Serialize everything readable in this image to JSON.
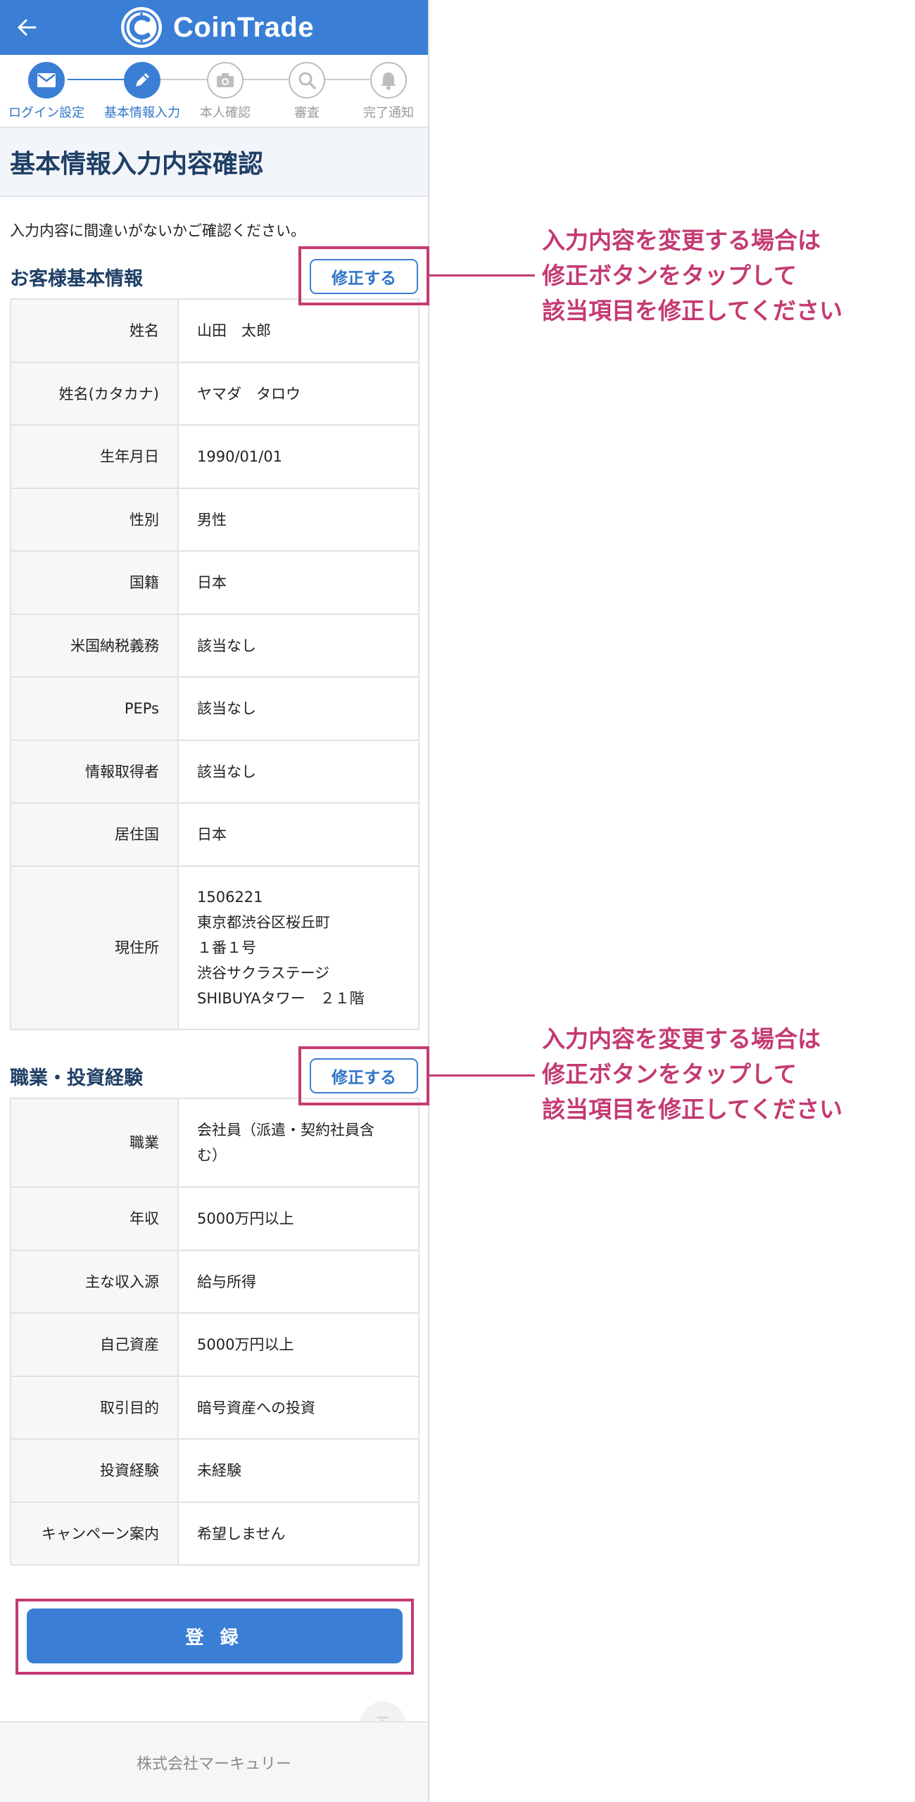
{
  "app": {
    "logo_text": "CoinTrade",
    "brand_color": "#3a7fd5",
    "accent_color": "#c43a72"
  },
  "header": {
    "back_icon": "arrow-left-icon",
    "logo_icon": "coin-logo-icon"
  },
  "steps": [
    {
      "label": "ログイン設定",
      "icon": "envelope-icon",
      "active": true
    },
    {
      "label": "基本情報入力",
      "icon": "pencil-icon",
      "active": true
    },
    {
      "label": "本人確認",
      "icon": "camera-icon",
      "active": false
    },
    {
      "label": "審査",
      "icon": "search-icon",
      "active": false
    },
    {
      "label": "完了通知",
      "icon": "bell-icon",
      "active": false
    }
  ],
  "page": {
    "title": "基本情報入力内容確認",
    "intro": "入力内容に間違いがないかご確認ください。"
  },
  "section1": {
    "title": "お客様基本情報",
    "edit_label": "修正する",
    "rows": [
      {
        "label": "姓名",
        "value": "山田　太郎"
      },
      {
        "label": "姓名(カタカナ)",
        "value": "ヤマダ　タロウ"
      },
      {
        "label": "生年月日",
        "value": "1990/01/01"
      },
      {
        "label": "性別",
        "value": "男性"
      },
      {
        "label": "国籍",
        "value": "日本"
      },
      {
        "label": "米国納税義務",
        "value": "該当なし"
      },
      {
        "label": "PEPs",
        "value": "該当なし"
      },
      {
        "label": "情報取得者",
        "value": "該当なし"
      },
      {
        "label": "居住国",
        "value": "日本"
      },
      {
        "label": "現住所",
        "value_lines": [
          "1506221",
          "東京都渋谷区桜丘町",
          "１番１号",
          "渋谷サクラステージ",
          "SHIBUYAタワー　２１階"
        ]
      }
    ]
  },
  "section2": {
    "title": "職業・投資経験",
    "edit_label": "修正する",
    "rows": [
      {
        "label": "職業",
        "value_lines": [
          "会社員（派遣・契約社員含",
          "む）"
        ]
      },
      {
        "label": "年収",
        "value": "5000万円以上"
      },
      {
        "label": "主な収入源",
        "value": "給与所得"
      },
      {
        "label": "自己資産",
        "value": "5000万円以上"
      },
      {
        "label": "取引目的",
        "value": "暗号資産への投資"
      },
      {
        "label": "投資経験",
        "value": "未経験"
      },
      {
        "label": "キャンペーン案内",
        "value": "希望しません"
      }
    ]
  },
  "register_label": "登 録",
  "scroll_top_icon": "arrow-up-icon",
  "footer_text": "株式会社マーキュリー",
  "annotation1": [
    "入力内容を変更する場合は",
    "修正ボタンをタップして",
    "該当項目を修正してください"
  ],
  "annotation2": [
    "入力内容を変更する場合は",
    "修正ボタンをタップして",
    "該当項目を修正してください"
  ]
}
